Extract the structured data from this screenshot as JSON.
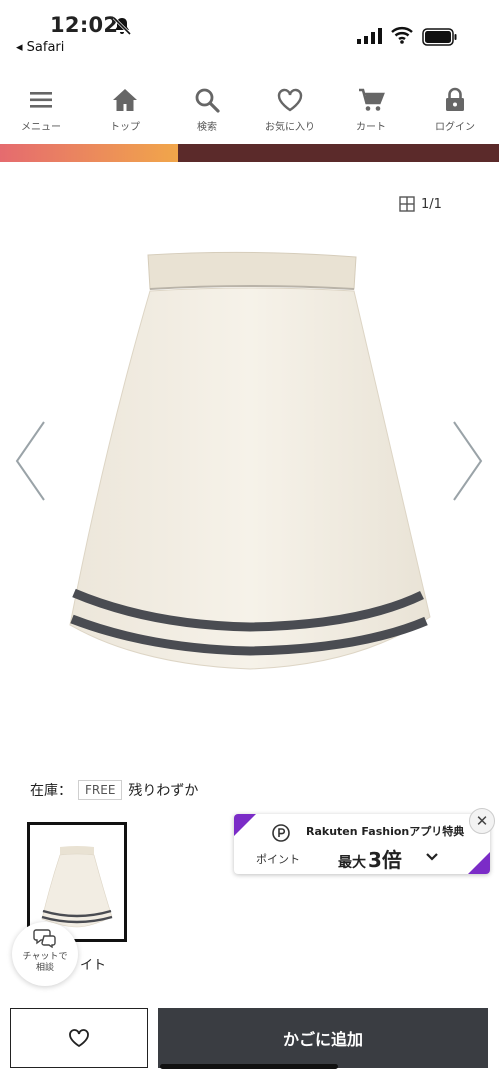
{
  "status_bar": {
    "time": "12:02",
    "back_label": "◂ Safari"
  },
  "nav": {
    "items": [
      {
        "label": "メニュー",
        "icon": "menu-icon"
      },
      {
        "label": "トップ",
        "icon": "home-icon"
      },
      {
        "label": "検索",
        "icon": "search-icon"
      },
      {
        "label": "お気に入り",
        "icon": "heart-icon"
      },
      {
        "label": "カート",
        "icon": "cart-icon"
      },
      {
        "label": "ログイン",
        "icon": "lock-icon"
      }
    ]
  },
  "gallery": {
    "counter": "1/1"
  },
  "stock": {
    "label": "在庫：",
    "size": "FREE",
    "status": "残りわずか"
  },
  "thumb": {
    "color_label": "イト"
  },
  "promo": {
    "title": "Rakuten Fashionアプリ特典",
    "point_label": "ポイント",
    "max_label": "最大",
    "multiplier": "3倍"
  },
  "chat": {
    "line1": "チャットで",
    "line2": "相談"
  },
  "actions": {
    "add_to_cart": "かごに追加"
  },
  "colors": {
    "cart_button_bg": "#3a3d42",
    "promo_accent": "#7b2cc7"
  }
}
